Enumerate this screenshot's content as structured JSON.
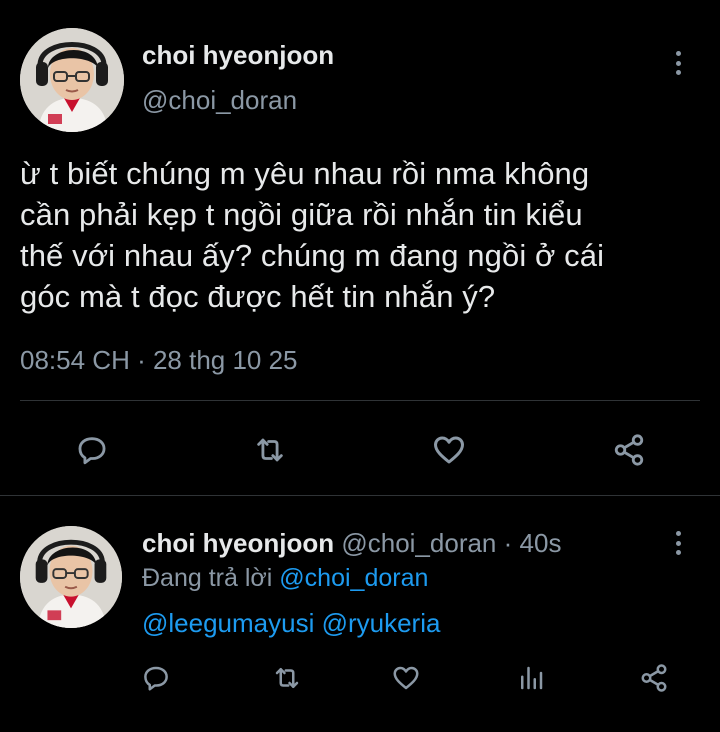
{
  "main_tweet": {
    "display_name": "choi hyeonjoon",
    "handle": "@choi_doran",
    "text_lines": [
      "ừ t biết chúng m yêu nhau rồi nma không",
      "cần phải kẹp t ngồi giữa rồi nhắn tin kiểu",
      "thế với nhau ấy? chúng m đang ngồi ở cái",
      "góc mà t đọc được hết tin nhắn ý?"
    ],
    "timestamp": "08:54 CH · 28 thg 10 25",
    "actions": [
      "reply-icon",
      "retweet-icon",
      "like-icon",
      "share-icon"
    ]
  },
  "reply": {
    "display_name": "choi hyeonjoon",
    "handle": "@choi_doran",
    "age": "· 40s",
    "replying_prefix": "Đang trả lời",
    "replying_to": "@choi_doran",
    "mentions": "@leegumayusi @ryukeria",
    "actions": [
      "reply-icon",
      "retweet-icon",
      "like-icon",
      "views-icon",
      "share-icon"
    ]
  },
  "colors": {
    "background": "#000000",
    "text": "#e7e9ea",
    "muted": "#8b98a5",
    "link": "#1d9bf0",
    "divider": "#2f3336"
  }
}
